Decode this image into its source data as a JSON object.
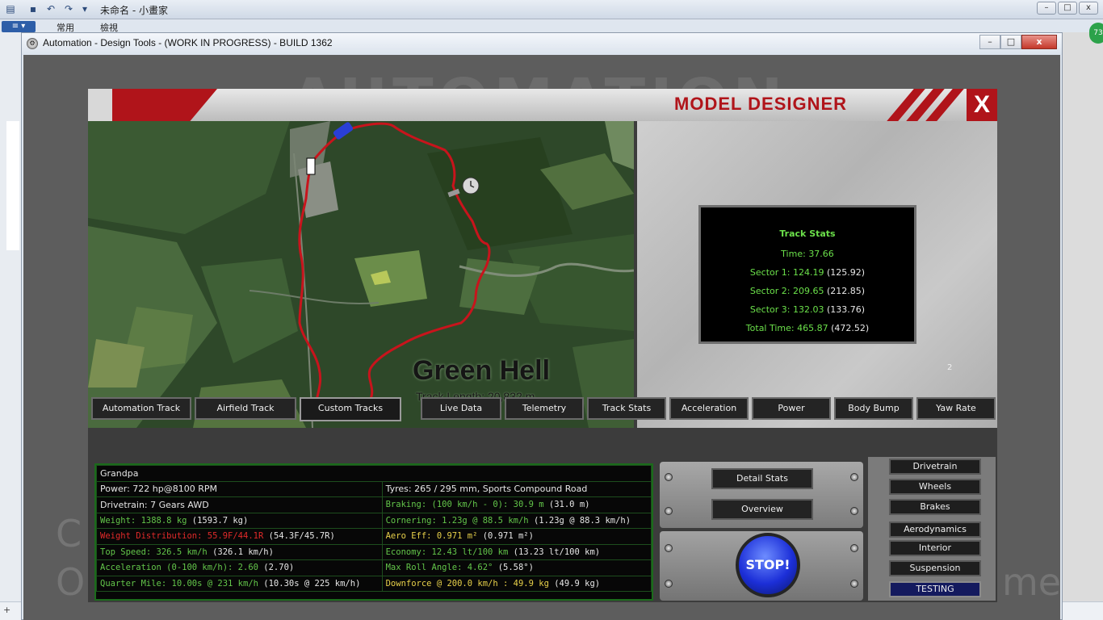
{
  "host": {
    "title": "未命名 - 小畫家",
    "file_menu": "",
    "tabs": [
      "常用",
      "檢視"
    ],
    "badge": "73",
    "status": "+"
  },
  "window": {
    "title": "Automation - Design Tools - (WORK IN PROGRESS) - BUILD 1362",
    "controls": {
      "minimize": "–",
      "maximize": "□",
      "close": "x"
    }
  },
  "background": {
    "logo": "AUTOMATION",
    "ghost_left_1": "C",
    "ghost_left_2": "O",
    "ghost_right": "me"
  },
  "designer": {
    "title": "MODEL DESIGNER",
    "close_label": "X"
  },
  "map": {
    "track_name": "Green Hell",
    "track_length": "Track Length: 20,832 m"
  },
  "track_stats": {
    "title": "Track Stats",
    "time_label": "Time:",
    "time": "37.66",
    "sector1_label": "Sector 1:",
    "sector1": "124.19",
    "sector1_ref": "(125.92)",
    "sector2_label": "Sector 2:",
    "sector2": "209.65",
    "sector2_ref": "(212.85)",
    "sector3_label": "Sector 3:",
    "sector3": "132.03",
    "sector3_ref": "(133.76)",
    "total_label": "Total Time:",
    "total": "465.87",
    "total_ref": "(472.52)",
    "page": "2"
  },
  "track_tabs": [
    "Automation Track",
    "Airfield Track",
    "Custom Tracks"
  ],
  "data_tabs": [
    "Live Data",
    "Telemetry",
    "Track Stats",
    "Acceleration",
    "Power",
    "Body Bump",
    "Yaw Rate"
  ],
  "stats": {
    "model_name": "Grandpa",
    "power": "Power: 722 hp@8100 RPM",
    "tyres": "Tyres: 265 / 295 mm, Sports Compound Road",
    "drivetrain": "Drivetrain: 7 Gears AWD",
    "braking": "Braking: (100 km/h - 0): 30.9 m",
    "braking_ref": " (31.0 m)",
    "weight": "Weight: 1388.8 kg",
    "weight_ref": " (1593.7 kg)",
    "cornering": "Cornering: 1.23g @ 88.5 km/h",
    "cornering_ref": " (1.23g @ 88.3 km/h)",
    "weight_dist": "Weight Distribution: 55.9F/44.1R",
    "weight_dist_ref": " (54.3F/45.7R)",
    "aero_eff": "Aero Eff: 0.971 m²",
    "aero_eff_ref": " (0.971 m²)",
    "top_speed": "Top Speed: 326.5 km/h",
    "top_speed_ref": " (326.1 km/h)",
    "economy": "Economy: 12.43 lt/100 km",
    "economy_ref": " (13.23 lt/100 km)",
    "acceleration": "Acceleration (0-100 km/h): 2.60",
    "acceleration_ref": " (2.70)",
    "roll_angle": "Max Roll Angle: 4.62°",
    "roll_angle_ref": " (5.58°)",
    "quarter_mile": "Quarter Mile: 10.00s @ 231 km/h",
    "quarter_mile_ref": " (10.30s @ 225 km/h)",
    "downforce": "Downforce @ 200.0 km/h : 49.9 kg",
    "downforce_ref": " (49.9 kg)"
  },
  "controls": {
    "detail_stats": "Detail Stats",
    "overview": "Overview",
    "stop": "STOP!"
  },
  "side_menu": [
    "Drivetrain",
    "Wheels",
    "Brakes",
    "Aerodynamics",
    "Interior",
    "Suspension",
    "TESTING"
  ],
  "colors": {
    "accent_red": "#b0141a",
    "stat_green": "#63c64a",
    "stat_red": "#e12a2a",
    "stat_yellow": "#e7d04a",
    "track_line": "#c8141c"
  }
}
